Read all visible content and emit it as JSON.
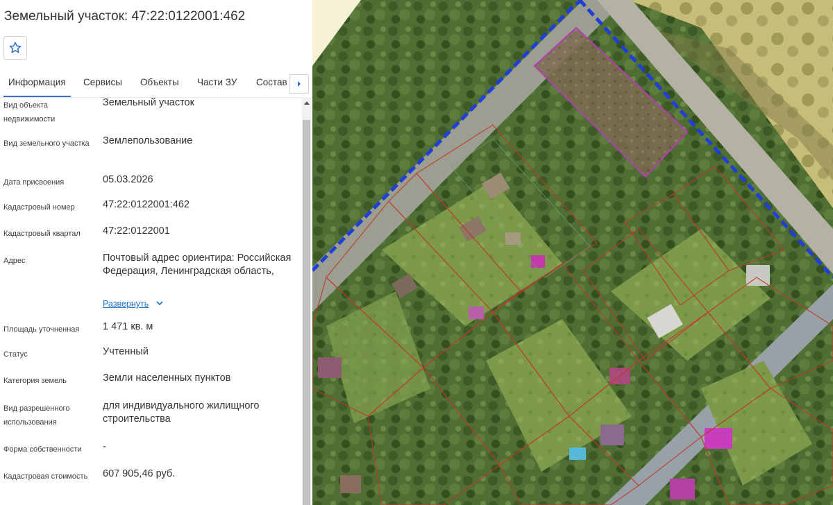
{
  "panel": {
    "title": "Земельный участок: 47:22:0122001:462",
    "favorite_icon": "star-outline-icon",
    "tabs": [
      {
        "label": "Информация",
        "active": true
      },
      {
        "label": "Сервисы",
        "active": false
      },
      {
        "label": "Объекты",
        "active": false
      },
      {
        "label": "Части ЗУ",
        "active": false
      },
      {
        "label": "Состав",
        "active": false
      }
    ],
    "tabs_next_icon": "caret-right-icon",
    "expand_label": "Развернуть",
    "fields": [
      {
        "label": "Вид объекта недвижимости",
        "value": "Земельный участок"
      },
      {
        "label": "Вид земельного участка",
        "value": "Землепользование"
      },
      {
        "label": "Дата присвоения",
        "value": "05.03.2026"
      },
      {
        "label": "Кадастровый номер",
        "value": "47:22:0122001:462"
      },
      {
        "label": "Кадастровый квартал",
        "value": "47:22:0122001"
      },
      {
        "label": "Адрес",
        "value": "Почтовый адрес ориентира: Российская Федерация, Ленинградская область,"
      },
      {
        "label": "Площадь уточненная",
        "value": "1 471 кв. м"
      },
      {
        "label": "Статус",
        "value": "Учтенный"
      },
      {
        "label": "Категория земель",
        "value": "Земли населенных пунктов"
      },
      {
        "label": "Вид разрешенного использования",
        "value": "для индивидуального жилищного строительства"
      },
      {
        "label": "Форма собственности",
        "value": "-"
      },
      {
        "label": "Кадастровая стоимость",
        "value": "607 905,46 руб."
      }
    ]
  },
  "colors": {
    "accent": "#3a6fd2",
    "link": "#1b73c8",
    "selected_parcel": "#b43cb4",
    "parcel_border": "#c0392b",
    "boundary": "#1f3fd6"
  }
}
